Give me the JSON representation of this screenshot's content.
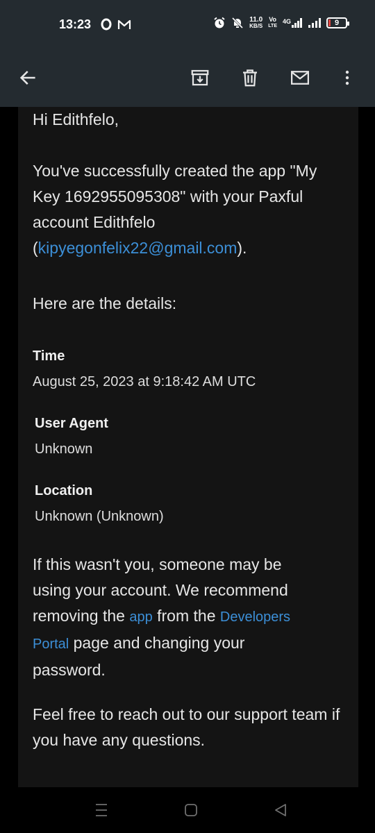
{
  "status_bar": {
    "time": "13:23",
    "left_icons": [
      "opera-icon",
      "gmail-icon"
    ],
    "net_speed_value": "11.0",
    "net_speed_unit": "KB/S",
    "volte_top": "Vo",
    "volte_bottom": "LTE",
    "network_type": "4G",
    "battery_level": "9"
  },
  "toolbar": {
    "icons": [
      "back-arrow-icon",
      "archive-icon",
      "delete-icon",
      "mark-unread-icon",
      "more-vert-icon"
    ]
  },
  "email": {
    "greeting": "Hi Edithfelo,",
    "p1_before": "You've successfully created the app \"My Key 1692955095308\" with your Paxful account Edithfelo (",
    "p1_email": "kipyegonfelix22@gmail.com",
    "p1_after": ").",
    "details_intro": "Here are the details:",
    "time_label": "Time",
    "time_value": "August 25, 2023 at 9:18:42 AM UTC",
    "ua_label": "User Agent",
    "ua_value": "Unknown",
    "loc_label": "Location",
    "loc_value": "Unknown (Unknown)",
    "warn_1": "If this wasn't you, someone may be using your account. We recommend removing the ",
    "warn_link_app": "app",
    "warn_2": " from the ",
    "warn_link_portal": "Developers Portal",
    "warn_3": " page and changing your password.",
    "support": "Feel free to reach out to our support team if you have any questions."
  },
  "nav_bar": {
    "icons": [
      "recent-apps-icon",
      "home-icon",
      "back-icon"
    ]
  },
  "colors": {
    "bar_bg": "#242b30",
    "card_bg": "#141414",
    "link": "#3c8fd7"
  }
}
